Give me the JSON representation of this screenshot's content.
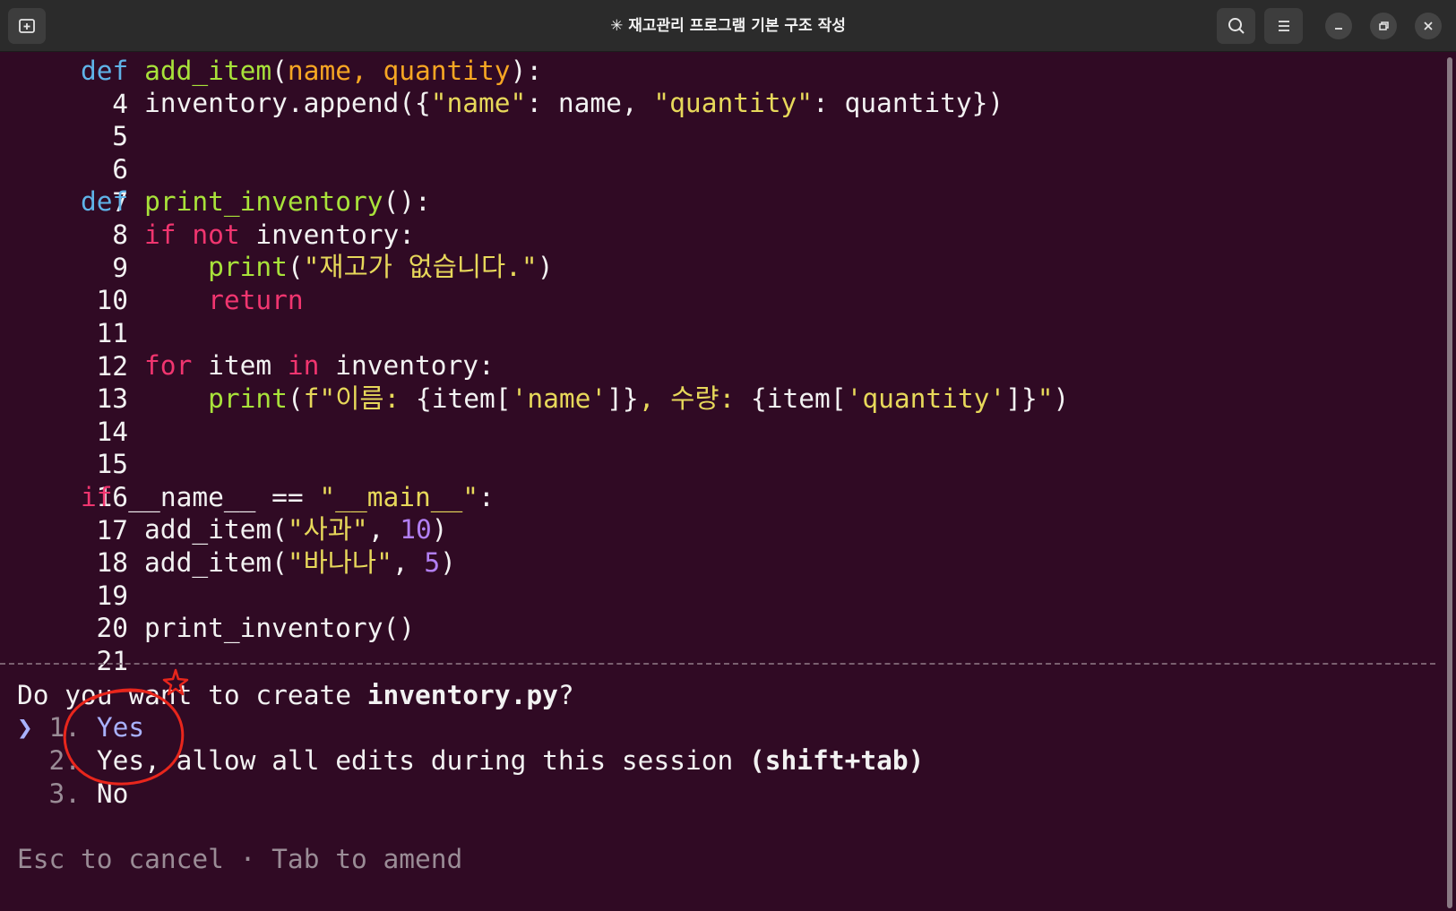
{
  "window": {
    "title": "✳ 재고관리 프로그램 기본 구조 작성",
    "icons": {
      "new_tab": "new-tab-icon",
      "search": "search-icon",
      "menu": "hamburger-menu-icon",
      "minimize": "minimize-icon",
      "maximize": "restore-icon",
      "close": "close-icon"
    }
  },
  "code": {
    "l4": {
      "n": "4",
      "t1": "def",
      "t2": " ",
      "t3": "add_item",
      "t4": "(",
      "t5": "name, quantity",
      "t6": "):"
    },
    "l5": {
      "n": "5",
      "t1": "    inventory.append({",
      "t2": "\"name\"",
      "t3": ": name, ",
      "t4": "\"quantity\"",
      "t5": ": quantity})"
    },
    "l6": {
      "n": "6"
    },
    "l7": {
      "n": "7"
    },
    "l8": {
      "n": "8",
      "t1": "def",
      "t2": " ",
      "t3": "print_inventory",
      "t4": "():"
    },
    "l9": {
      "n": "9",
      "t1": "    ",
      "t2": "if not",
      "t3": " inventory:"
    },
    "l10": {
      "n": "10",
      "t1": "        ",
      "t2": "print",
      "t3": "(",
      "t4": "\"재고가 없습니다.\"",
      "t5": ")"
    },
    "l11": {
      "n": "11",
      "t1": "        ",
      "t2": "return"
    },
    "l12": {
      "n": "12"
    },
    "l13": {
      "n": "13",
      "t1": "    ",
      "t2": "for",
      "t3": " item ",
      "t4": "in",
      "t5": " inventory:"
    },
    "l14": {
      "n": "14",
      "t1": "        ",
      "t2": "print",
      "t3": "(",
      "t4": "f\"이름: ",
      "t5": "{item[",
      "t6": "'name'",
      "t7": "]}",
      "t8": ", 수량: ",
      "t9": "{item[",
      "t10": "'quantity'",
      "t11": "]}",
      "t12": "\"",
      "t13": ")"
    },
    "l15": {
      "n": "15"
    },
    "l16": {
      "n": "16"
    },
    "l17": {
      "n": "17",
      "t1": "if",
      "t2": " __name__ == ",
      "t3": "\"__main__\"",
      "t4": ":"
    },
    "l18": {
      "n": "18",
      "t1": "    add_item(",
      "t2": "\"사과\"",
      "t3": ", ",
      "t4": "10",
      "t5": ")"
    },
    "l19": {
      "n": "19",
      "t1": "    add_item(",
      "t2": "\"바나나\"",
      "t3": ", ",
      "t4": "5",
      "t5": ")"
    },
    "l20": {
      "n": "20"
    },
    "l21": {
      "n": "21",
      "t1": "    print_inventory()"
    }
  },
  "prompt": {
    "question_pre": "Do you want to create ",
    "question_file": "inventory.py",
    "question_post": "?",
    "cursor": "❯",
    "options": [
      {
        "num": "1.",
        "label": "Yes"
      },
      {
        "num": "2.",
        "label": "Yes, allow all edits during this session ",
        "hint": "(shift+tab)"
      },
      {
        "num": "3.",
        "label": "No"
      }
    ],
    "footer": "Esc to cancel · Tab to amend"
  },
  "colors": {
    "background": "#300a24",
    "keyword_def": "#5fb3e8",
    "function": "#a8e23a",
    "parameter": "#f6a623",
    "keyword": "#f0356f",
    "string": "#e7d85a",
    "number": "#b27ff3",
    "selected": "#a9b2ff",
    "annotation": "#e8261c"
  }
}
